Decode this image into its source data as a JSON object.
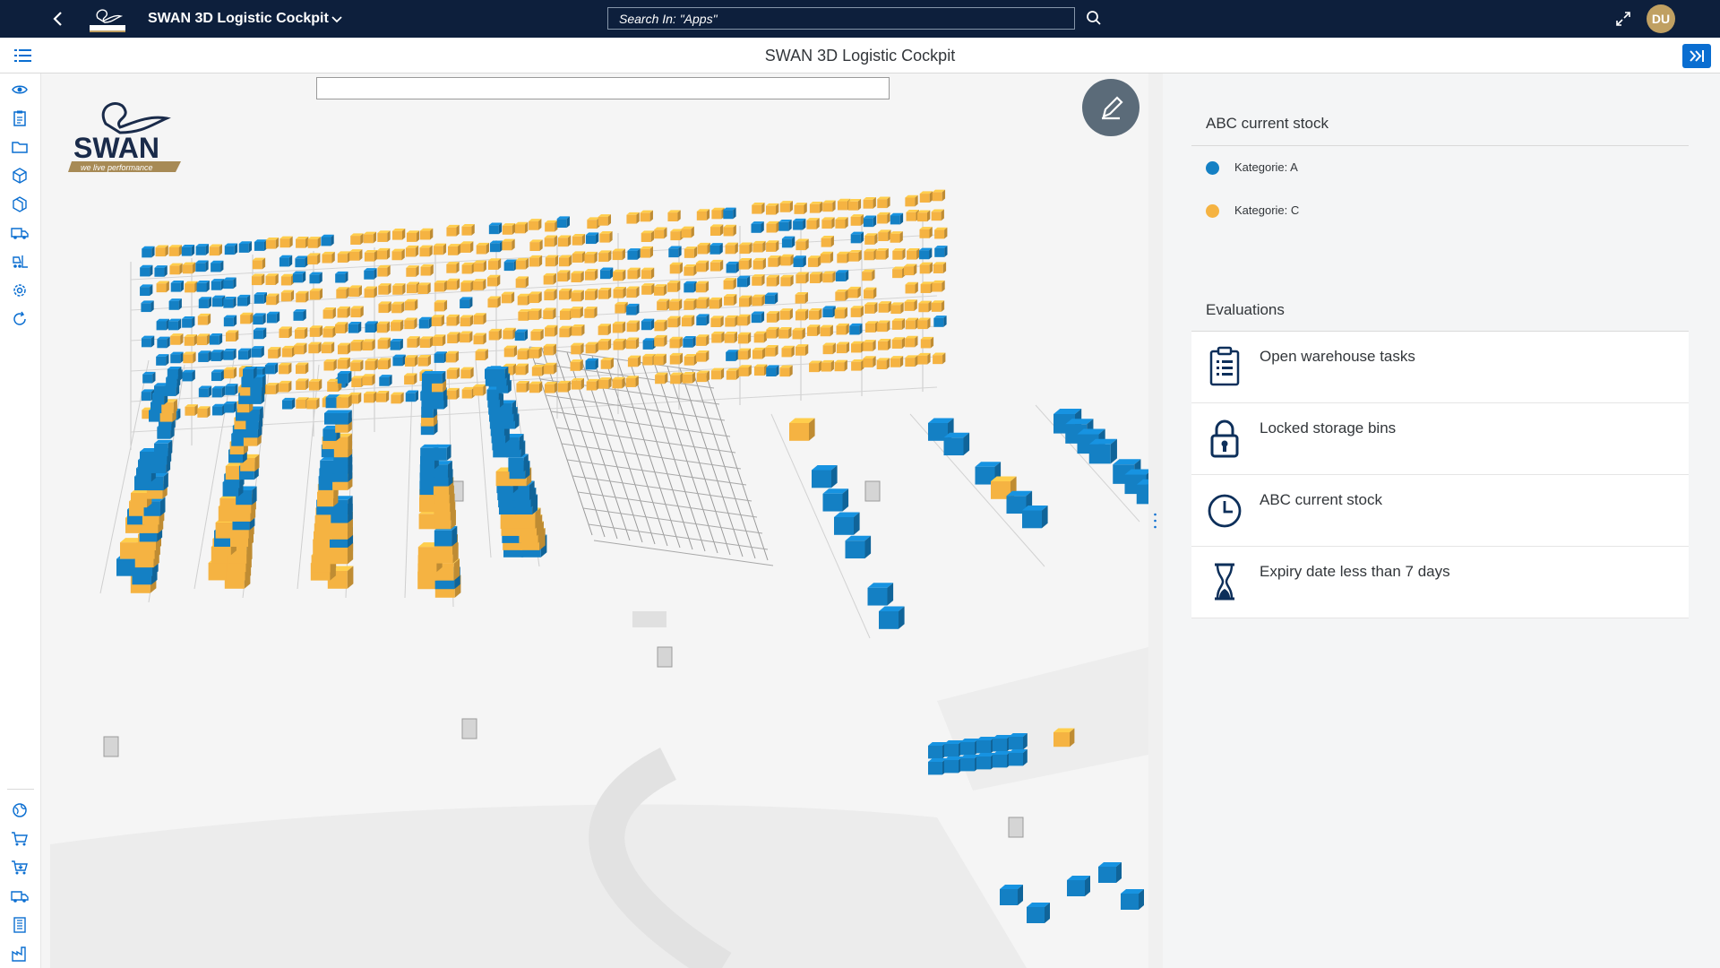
{
  "shell": {
    "app_title": "SWAN 3D Logistic Cockpit",
    "search_text": "Search In: \"Apps\"",
    "avatar_initials": "DU",
    "colors": {
      "shell_bg": "#0d1f3c",
      "avatar_bg": "#c0a062",
      "accent": "#0a6ed1"
    }
  },
  "page": {
    "title": "SWAN 3D Logistic Cockpit"
  },
  "nav": {
    "icons": [
      "list-icon",
      "eye-icon",
      "clipboard-icon",
      "folder-icon",
      "package-icon",
      "packages-icon",
      "truck-icon",
      "forklift-icon",
      "settings-icon",
      "refresh-icon",
      "globe-icon",
      "cart-icon",
      "cart-arrow-icon",
      "truck-icon",
      "building-icon",
      "factory-icon"
    ]
  },
  "logo": {
    "brand": "SWAN",
    "tagline": "we live performance"
  },
  "legend": {
    "title": "ABC current stock",
    "items": [
      {
        "label": "Kategorie: A",
        "color": "#1480c4"
      },
      {
        "label": "Kategorie: C",
        "color": "#f5b342"
      }
    ]
  },
  "evaluations": {
    "title": "Evaluations",
    "items": [
      {
        "label": "Open warehouse tasks",
        "icon": "clipboard-list-icon"
      },
      {
        "label": "Locked storage bins",
        "icon": "lock-icon"
      },
      {
        "label": "ABC current stock",
        "icon": "clock-icon"
      },
      {
        "label": "Expiry date less than 7 days",
        "icon": "hourglass-icon"
      }
    ]
  }
}
